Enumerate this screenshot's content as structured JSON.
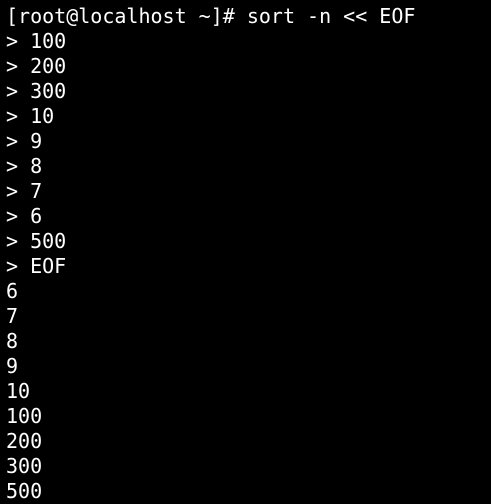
{
  "terminal": {
    "background": "#000000",
    "foreground": "#ffffff",
    "lines": [
      "[root@localhost ~]# sort -n << EOF",
      "> 100",
      "> 200",
      "> 300",
      "> 10",
      "> 9",
      "> 8",
      "> 7",
      "> 6",
      "> 500",
      "> EOF",
      "6",
      "7",
      "8",
      "9",
      "10",
      "100",
      "200",
      "300",
      "500"
    ]
  }
}
